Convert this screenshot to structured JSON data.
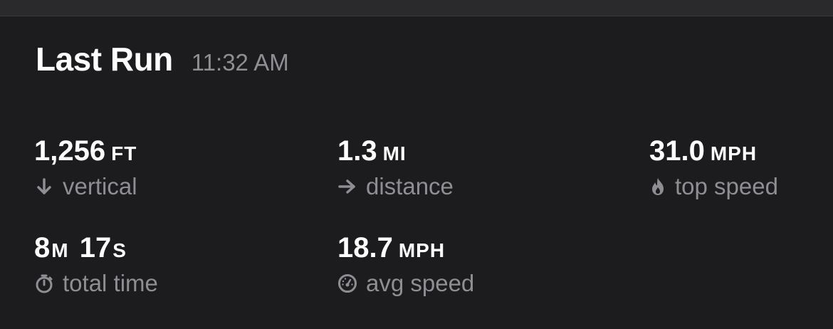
{
  "header": {
    "title": "Last Run",
    "time": "11:32 AM"
  },
  "stats": {
    "vertical": {
      "value": "1,256",
      "unit": "FT",
      "label": "vertical",
      "icon": "arrow-down-icon"
    },
    "distance": {
      "value": "1.3",
      "unit": "MI",
      "label": "distance",
      "icon": "arrow-right-icon"
    },
    "top_speed": {
      "value": "31.0",
      "unit": "MPH",
      "label": "top speed",
      "icon": "flame-icon"
    },
    "total_time": {
      "minutes": "8",
      "minutes_unit": "M",
      "seconds": "17",
      "seconds_unit": "S",
      "label": "total time",
      "icon": "stopwatch-icon"
    },
    "avg_speed": {
      "value": "18.7",
      "unit": "MPH",
      "label": "avg speed",
      "icon": "speedometer-icon"
    }
  },
  "colors": {
    "background": "#1c1c1e",
    "text_primary": "#ffffff",
    "text_secondary": "#8e8e93"
  }
}
